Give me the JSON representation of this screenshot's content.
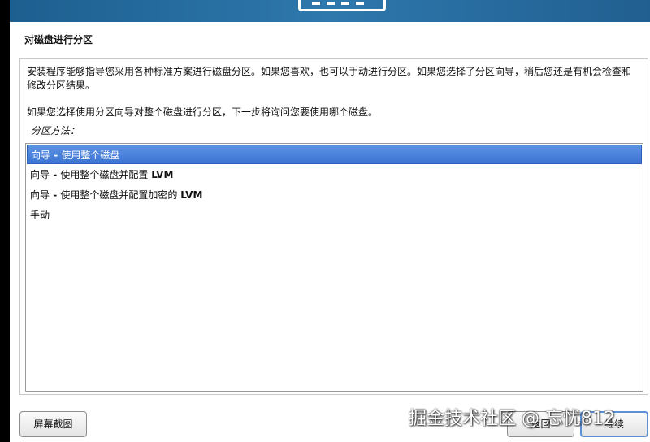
{
  "page": {
    "title": "对磁盘进行分区",
    "description": "安装程序能够指导您采用各种标准方案进行磁盘分区。如果您喜欢，也可以手动进行分区。如果您选择了分区向导，稍后您还是有机会检查和修改分区结果。",
    "description2": "如果您选择使用分区向导对整个磁盘进行分区，下一步将询问您要使用哪个磁盘。",
    "method_label": "分区方法："
  },
  "options": [
    {
      "prefix": "向导",
      "dash": " - ",
      "text": "使用整个磁盘",
      "suffix": "",
      "selected": true
    },
    {
      "prefix": "向导",
      "dash": " - ",
      "text": "使用整个磁盘并配置 ",
      "suffix": "LVM",
      "selected": false
    },
    {
      "prefix": "向导",
      "dash": " - ",
      "text": "使用整个磁盘并配置加密的 ",
      "suffix": "LVM",
      "selected": false
    },
    {
      "prefix": "手动",
      "dash": "",
      "text": "",
      "suffix": "",
      "selected": false
    }
  ],
  "buttons": {
    "screenshot": "屏幕截图",
    "back": "返回",
    "continue": "继续"
  },
  "watermark": "掘金技术社区 @ 忘忧812",
  "colors": {
    "selection": "#3b74d3",
    "banner": "#2e78ad"
  }
}
